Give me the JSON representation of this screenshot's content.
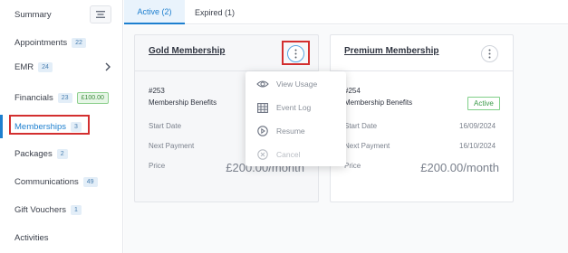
{
  "sidebar": {
    "items": [
      {
        "label": "Summary"
      },
      {
        "label": "Appointments",
        "badge": "22"
      },
      {
        "label": "EMR",
        "badge": "24"
      },
      {
        "label": "Financials",
        "badge": "23",
        "badge2": "£100.00"
      },
      {
        "label": "Memberships",
        "badge": "3"
      },
      {
        "label": "Packages",
        "badge": "2"
      },
      {
        "label": "Communications",
        "badge": "49"
      },
      {
        "label": "Gift Vouchers",
        "badge": "1"
      },
      {
        "label": "Activities"
      }
    ]
  },
  "tabs": [
    {
      "label": "Active (2)"
    },
    {
      "label": "Expired (1)"
    }
  ],
  "cards": [
    {
      "title": "Gold Membership",
      "number": "#253",
      "benefits": "Membership Benefits",
      "start_label": "Start Date",
      "next_label": "Next Payment",
      "price_label": "Price",
      "price": "£200.00/month"
    },
    {
      "title": "Premium Membership",
      "number": "#254",
      "benefits": "Membership Benefits",
      "status": "Active",
      "start_label": "Start Date",
      "start_value": "16/09/2024",
      "next_label": "Next Payment",
      "next_value": "16/10/2024",
      "price_label": "Price",
      "price": "£200.00/month"
    }
  ],
  "menu": {
    "items": [
      {
        "label": "View Usage",
        "icon": "eye-icon"
      },
      {
        "label": "Event Log",
        "icon": "table-icon"
      },
      {
        "label": "Resume",
        "icon": "play-circle-icon"
      },
      {
        "label": "Cancel",
        "icon": "close-circle-icon",
        "disabled": true
      }
    ]
  },
  "colors": {
    "accent": "#1d7fcf",
    "highlight": "#d32f2f",
    "active_status": "#3c9a4a"
  }
}
